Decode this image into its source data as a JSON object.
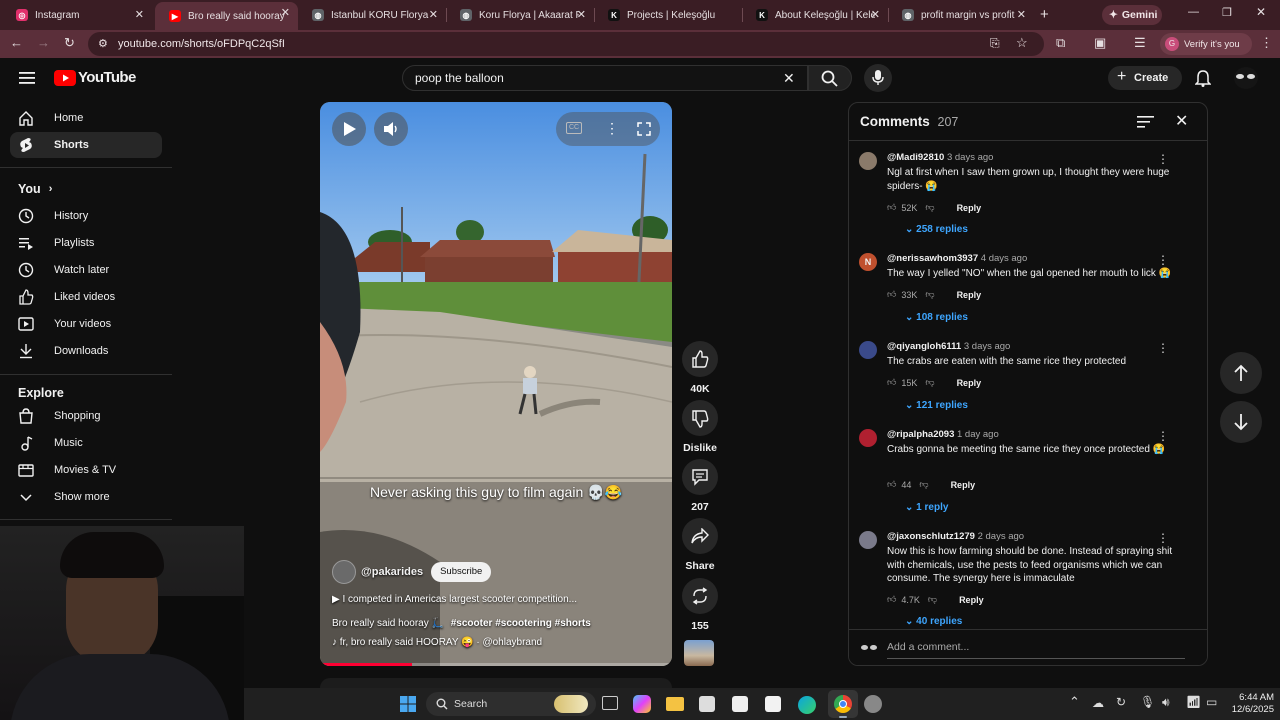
{
  "tabs": [
    {
      "label": "Instagram",
      "color": "#e1306c",
      "glyph": "◎"
    },
    {
      "label": "Bro really said hooray",
      "color": "#ff0000",
      "glyph": "▶",
      "active": true
    },
    {
      "label": "Istanbul KORU Florya I",
      "color": "#5f6368",
      "glyph": "◍"
    },
    {
      "label": "Koru Florya | Akaarat F",
      "color": "#5f6368",
      "glyph": "◍"
    },
    {
      "label": "Projects | Keleşoğlu",
      "color": "#000000",
      "glyph": "K"
    },
    {
      "label": "About Keleşoğlu | Kele",
      "color": "#000000",
      "glyph": "K"
    },
    {
      "label": "profit margin vs profit",
      "color": "#5f6368",
      "glyph": "◍"
    }
  ],
  "gemini_label": "Gemini",
  "url": "youtube.com/shorts/oFDPqC2qSfI",
  "verify_label": "Verify it's you",
  "youtube": {
    "logo_text": "YouTube",
    "search_query": "poop the balloon",
    "create_label": "Create"
  },
  "sidebar": {
    "main": [
      {
        "label": "Home",
        "icon": "home-icon"
      },
      {
        "label": "Shorts",
        "icon": "shorts-icon",
        "selected": true
      }
    ],
    "you_header": "You",
    "you_items": [
      {
        "label": "History",
        "icon": "history-icon"
      },
      {
        "label": "Playlists",
        "icon": "playlists-icon"
      },
      {
        "label": "Watch later",
        "icon": "watch-later-icon"
      },
      {
        "label": "Liked videos",
        "icon": "liked-icon"
      },
      {
        "label": "Your videos",
        "icon": "your-videos-icon"
      },
      {
        "label": "Downloads",
        "icon": "downloads-icon"
      }
    ],
    "explore_header": "Explore",
    "explore_items": [
      {
        "label": "Shopping",
        "icon": "shopping-icon"
      },
      {
        "label": "Music",
        "icon": "music-icon"
      },
      {
        "label": "Movies & TV",
        "icon": "movies-icon"
      },
      {
        "label": "Show more",
        "icon": "chevron-down-icon"
      }
    ]
  },
  "video": {
    "caption": "Never asking this guy to film again 💀😂",
    "channel": "@pakarides",
    "subscribe_label": "Subscribe",
    "description": "▶ I competed in Americas largest scooter competition...",
    "title_line": "Bro really said hooray 🛴",
    "hashtags": "#scooter #scootering #shorts",
    "sound": "fr, bro really said HOORAY 😜 · @ohlaybrand"
  },
  "actions": {
    "likes": "40K",
    "dislike_label": "Dislike",
    "comments": "207",
    "share_label": "Share",
    "remix": "155"
  },
  "comments_panel": {
    "title": "Comments",
    "count": "207",
    "add_placeholder": "Add a comment...",
    "items": [
      {
        "user": "@Madi92810",
        "time": "3 days ago",
        "text": "Ngl at first when I saw them grown up, I thought they were huge spiders- 😭",
        "likes": "52K",
        "replies": "258 replies",
        "avatar_color": "#8a7a6a"
      },
      {
        "user": "@nerissawhom3937",
        "time": "4 days ago",
        "text": "The way I yelled \"NO\" when the gal opened her mouth to lick 😭",
        "likes": "33K",
        "replies": "108 replies",
        "avatar_color": "#c0502e",
        "avatar_letter": "N"
      },
      {
        "user": "@qiyangloh6111",
        "time": "3 days ago",
        "text": "The crabs are eaten with the same rice they protected",
        "likes": "15K",
        "replies": "121 replies",
        "avatar_color": "#3a4a8a"
      },
      {
        "user": "@ripalpha2093",
        "time": "1 day ago",
        "text": "Crabs gonna be meeting the same rice they once protected 😭",
        "likes": "44",
        "replies": "1 reply",
        "avatar_color": "#b02030"
      },
      {
        "user": "@jaxonschlutz1279",
        "time": "2 days ago",
        "text": "Now this is how farming should be done. Instead of spraying shit with chemicals, use the pests to feed organisms which we can consume. The synergy here is immaculate",
        "likes": "4.7K",
        "replies": "40 replies",
        "avatar_color": "#7a7a8a"
      }
    ],
    "reply_label": "Reply"
  },
  "taskbar": {
    "search_label": "Search",
    "time": "6:44 AM",
    "date": "12/6/2025"
  }
}
